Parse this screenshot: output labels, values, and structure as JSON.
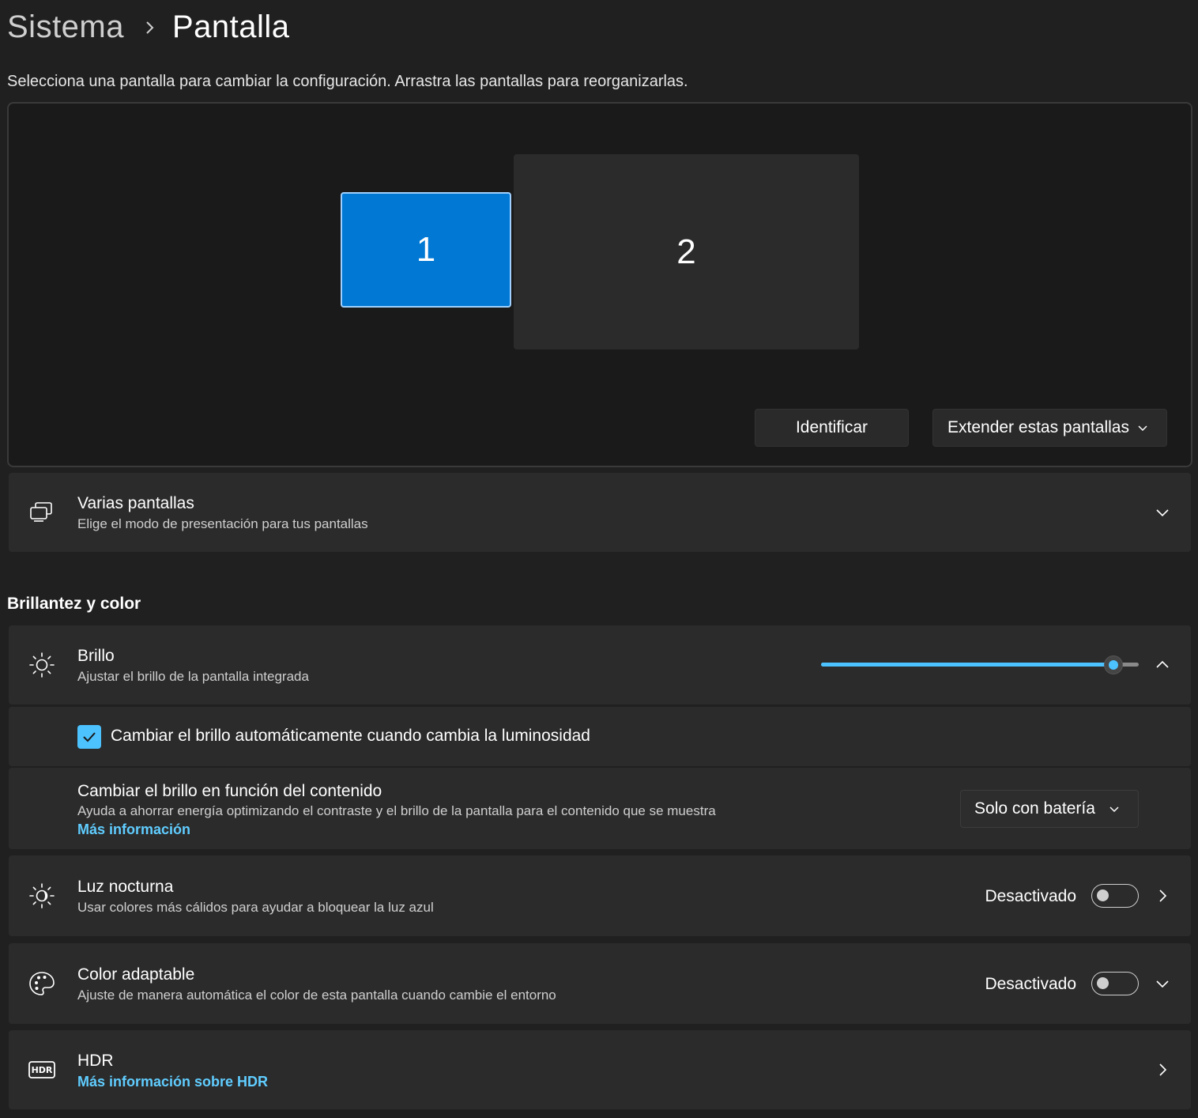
{
  "breadcrumb": {
    "parent": "Sistema",
    "current": "Pantalla"
  },
  "instruction": "Selecciona una pantalla para cambiar la configuración. Arrastra las pantallas para reorganizarlas.",
  "arrangement": {
    "monitors": [
      {
        "label": "1",
        "selected": true
      },
      {
        "label": "2",
        "selected": false
      }
    ],
    "identify_label": "Identificar",
    "mode_select": {
      "value": "Extender estas pantallas"
    }
  },
  "multiple_displays": {
    "icon": "multiple-displays-icon",
    "title": "Varias pantallas",
    "subtitle": "Elige el modo de presentación para tus pantallas"
  },
  "brightness_section": {
    "title": "Brillantez y color",
    "brightness": {
      "icon": "sun-icon",
      "title": "Brillo",
      "subtitle": "Ajustar el brillo de la pantalla integrada",
      "value_fraction": 0.92
    },
    "auto_brightness": {
      "checked": true,
      "label": "Cambiar el brillo automáticamente cuando cambia la luminosidad"
    },
    "content_brightness": {
      "title": "Cambiar el brillo en función del contenido",
      "subtitle": "Ayuda a ahorrar energía optimizando el contraste y el brillo de la pantalla para el contenido que se muestra",
      "link": "Más información",
      "select_value": "Solo con batería"
    }
  },
  "night_light": {
    "icon": "night-light-icon",
    "title": "Luz nocturna",
    "subtitle": "Usar colores más cálidos para ayudar a bloquear la luz azul",
    "state_label": "Desactivado",
    "on": false
  },
  "adaptive_color": {
    "icon": "palette-icon",
    "title": "Color adaptable",
    "subtitle": "Ajuste de manera automática el color de esta pantalla cuando cambie el entorno",
    "state_label": "Desactivado",
    "on": false
  },
  "hdr": {
    "icon": "hdr-icon",
    "icon_text": "HDR",
    "title": "HDR",
    "link": "Más información sobre HDR"
  },
  "colors": {
    "accent": "#0078d4",
    "accent_light": "#4cc2ff",
    "link": "#60cdff",
    "background": "#202020",
    "card": "#2b2b2b"
  }
}
